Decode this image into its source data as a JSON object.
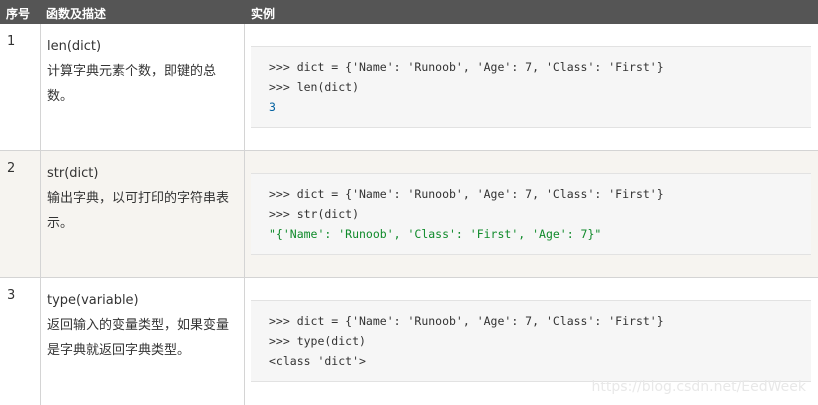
{
  "headers": {
    "no": "序号",
    "desc": "函数及描述",
    "example": "实例"
  },
  "rows": [
    {
      "no": "1",
      "func": "len(dict)",
      "desc": "计算字典元素个数，即键的总数。",
      "code": [
        ">>> dict = {'Name': 'Runoob', 'Age': 7, 'Class': 'First'}",
        ">>> len(dict)",
        "3"
      ]
    },
    {
      "no": "2",
      "func": "str(dict)",
      "desc": "输出字典，以可打印的字符串表示。",
      "code": [
        ">>> dict = {'Name': 'Runoob', 'Age': 7, 'Class': 'First'}",
        ">>> str(dict)",
        "\"{'Name': 'Runoob', 'Class': 'First', 'Age': 7}\""
      ]
    },
    {
      "no": "3",
      "func": "type(variable)",
      "desc": "返回输入的变量类型，如果变量是字典就返回字典类型。",
      "code": [
        ">>> dict = {'Name': 'Runoob', 'Age': 7, 'Class': 'First'}",
        ">>> type(dict)",
        "<class 'dict'>"
      ]
    }
  ],
  "watermark": "https://blog.csdn.net/EedWeek"
}
